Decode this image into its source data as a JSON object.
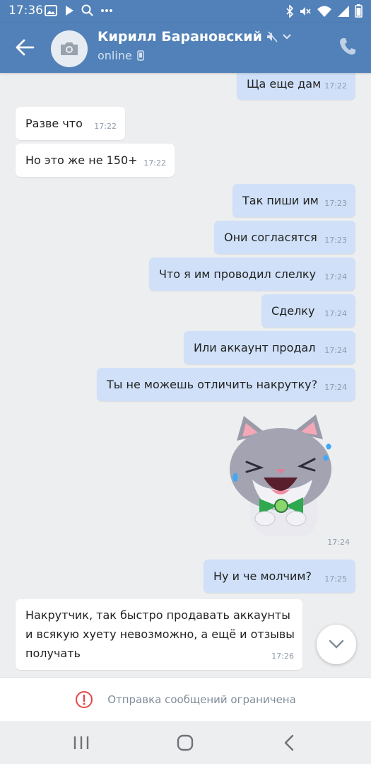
{
  "status_bar": {
    "time": "17:36",
    "icons": [
      "gallery-icon",
      "play-icon",
      "search-icon",
      "more-dots-icon"
    ],
    "right_icons": [
      "bluetooth-icon",
      "mute-icon",
      "wifi-icon",
      "signal-icon",
      "battery-icon"
    ]
  },
  "header": {
    "contact_name": "Кирилл Барановский",
    "status": "online",
    "icons": [
      "back-arrow-icon",
      "camera-icon",
      "muted-speaker-icon",
      "chevron-down-icon",
      "mobile-icon",
      "phone-icon"
    ]
  },
  "messages": [
    {
      "direction": "out",
      "text": "Ща еще дам",
      "time": "17:22"
    },
    {
      "direction": "in",
      "text": "Разве что",
      "time": "17:22"
    },
    {
      "direction": "in",
      "text": "Но это же не 150+",
      "time": "17:22"
    },
    {
      "direction": "out",
      "text": "Так пиши им",
      "time": "17:23"
    },
    {
      "direction": "out",
      "text": "Они согласятся",
      "time": "17:23"
    },
    {
      "direction": "out",
      "text": "Что я им проводил слелку",
      "time": "17:24"
    },
    {
      "direction": "out",
      "text": "Сделку",
      "time": "17:24"
    },
    {
      "direction": "out",
      "text": "Или аккаунт продал",
      "time": "17:24"
    },
    {
      "direction": "out",
      "text": "Ты не можешь отличить накрутку?",
      "time": "17:24"
    },
    {
      "direction": "out",
      "sticker": "laughing-cat-sticker",
      "time": "17:24"
    },
    {
      "direction": "out",
      "text": "Ну и че молчим?",
      "time": "17:25"
    },
    {
      "direction": "in",
      "text_lines": [
        "Накрутчик, так быстро продавать аккаунты",
        "и всякую хуету невозможно, а ещё и отзывы",
        "получать"
      ],
      "time": "17:26"
    }
  ],
  "restriction": {
    "text": "Отправка сообщений ограничена",
    "icon": "alert-circle-icon",
    "accent": "#e64646"
  },
  "nav": {
    "icons": [
      "recent-apps-icon",
      "home-icon",
      "back-icon"
    ]
  },
  "colors": {
    "header": "#5181b8",
    "background": "#edeef0",
    "incoming_bubble": "#ffffff",
    "outgoing_bubble": "#cfe0f8"
  }
}
